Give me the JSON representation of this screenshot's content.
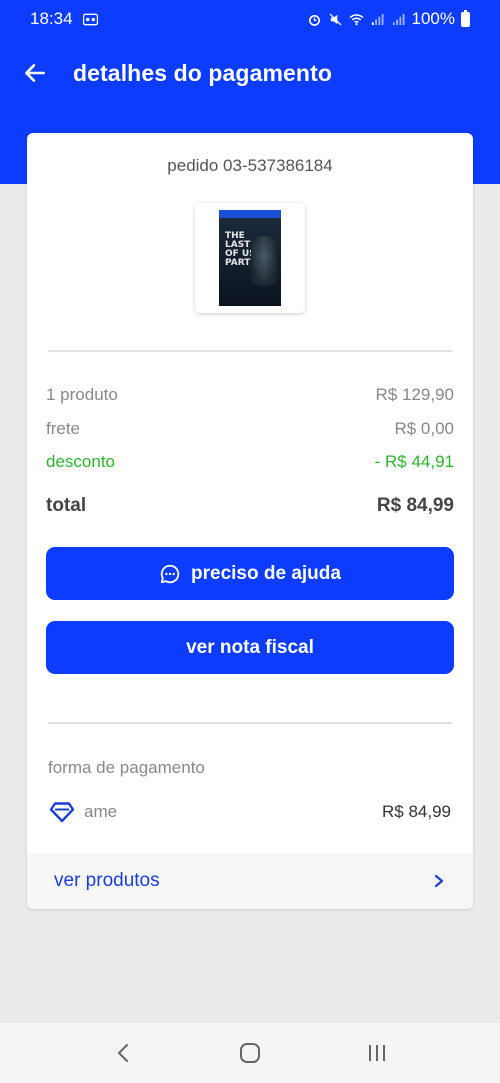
{
  "status_bar": {
    "time": "18:34",
    "battery": "100%"
  },
  "header": {
    "title": "detalhes do pagamento"
  },
  "order": {
    "id_label": "pedido 03-537386184",
    "product_image_alt": "The Last of Us Part II"
  },
  "summary": {
    "product_label": "1 produto",
    "product_value": "R$ 129,90",
    "shipping_label": "frete",
    "shipping_value": "R$ 0,00",
    "discount_label": "desconto",
    "discount_value": "- R$ 44,91",
    "total_label": "total",
    "total_value": "R$ 84,99"
  },
  "actions": {
    "help_label": "preciso de ajuda",
    "invoice_label": "ver nota fiscal"
  },
  "payment": {
    "section_label": "forma de pagamento",
    "method_name": "ame",
    "method_value": "R$ 84,99"
  },
  "footer_link": {
    "label": "ver produtos"
  },
  "colors": {
    "brand": "#0b3cff",
    "discount": "#30b030",
    "link": "#1a3ed6"
  },
  "icons": {
    "back": "arrow-left-icon",
    "help": "chat-bubble-icon",
    "payment": "ame-heart-icon",
    "footer": "chevron-right-icon"
  }
}
